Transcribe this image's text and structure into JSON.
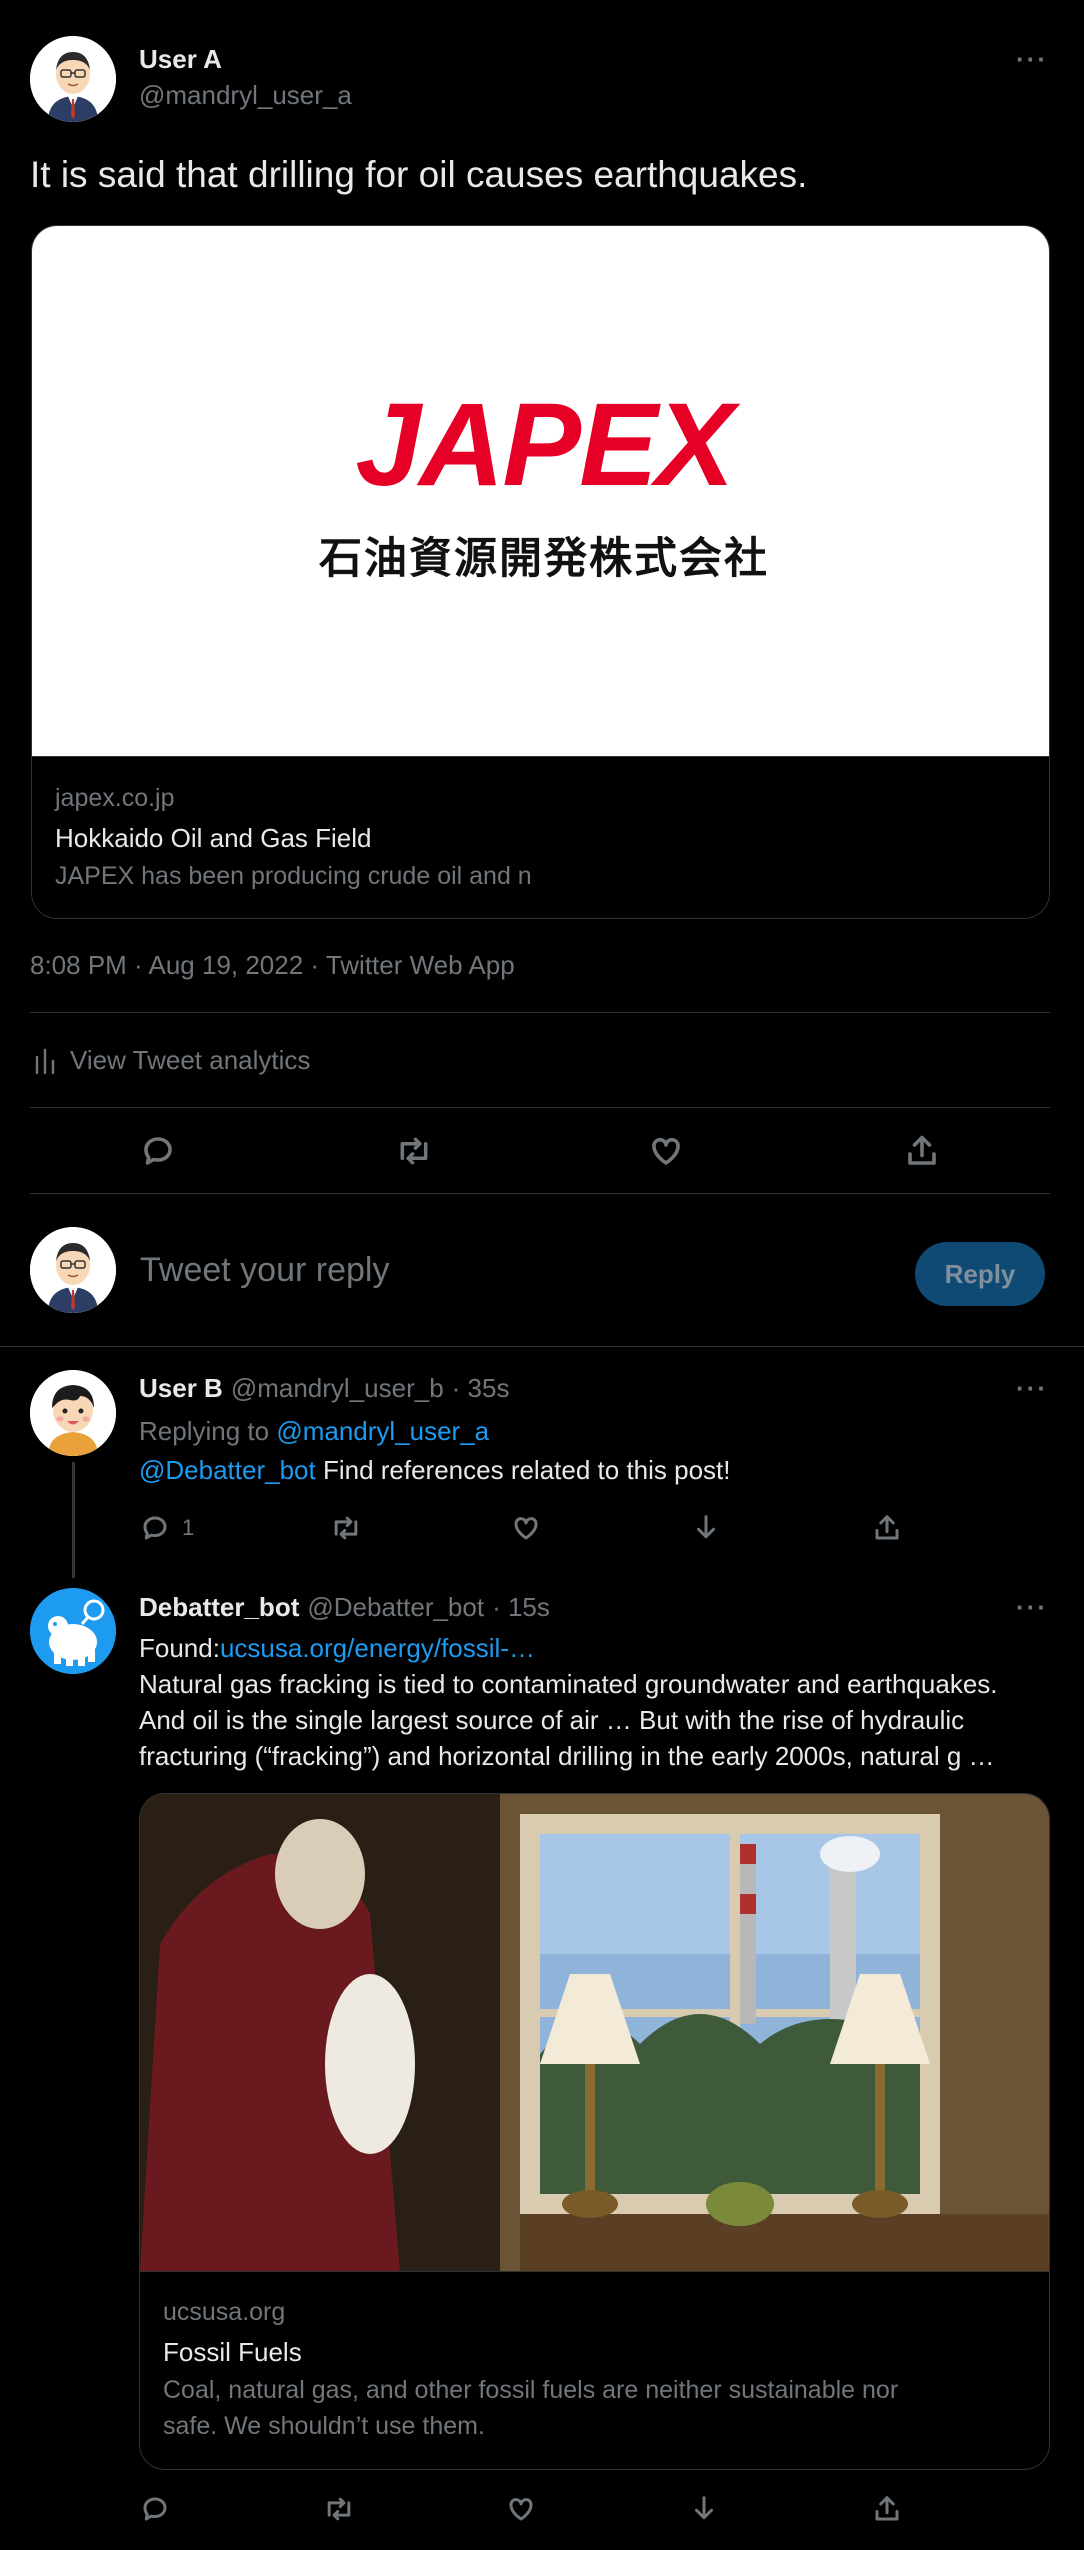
{
  "main_tweet": {
    "author_name": "User A",
    "author_handle": "@mandryl_user_a",
    "text": "It is said that drilling for oil causes earthquakes.",
    "card": {
      "logo_text": "JAPEX",
      "logo_subtext": "石油資源開発株式会社",
      "domain": "japex.co.jp",
      "title": "Hokkaido Oil and Gas Field",
      "description": "JAPEX has been producing crude oil and n"
    },
    "timestamp": "8:08 PM · Aug 19, 2022 · Twitter Web App",
    "analytics_label": "View Tweet analytics",
    "brand_color": "#e60026"
  },
  "composer": {
    "placeholder": "Tweet your reply",
    "reply_label": "Reply"
  },
  "reply1": {
    "author_name": "User B",
    "author_handle": "@mandryl_user_b",
    "time": "· 35s",
    "replying_prefix": "Replying to",
    "replying_to": "@mandryl_user_a",
    "mention": "@Debatter_bot",
    "text": "Find references related to this post!",
    "reply_count": "1"
  },
  "reply2": {
    "author_name": "Debatter_bot",
    "author_handle": "@Debatter_bot",
    "time": "· 15s",
    "found_prefix": "Found:",
    "found_link": "ucsusa.org/energy/fossil-…",
    "body_line1": "Natural gas fracking is tied to contaminated groundwater and earthquakes.",
    "body_line2": "And oil is the single largest source of air … But with the rise of hydraulic",
    "body_line3": "fracturing (“fracking”) and horizontal drilling in the early 2000s, natural g …",
    "card": {
      "domain": "ucsusa.org",
      "title": "Fossil Fuels",
      "desc_line1": "Coal, natural gas, and other fossil fuels are neither sustainable nor",
      "desc_line2": "safe. We shouldn’t use them."
    }
  },
  "colors": {
    "accent": "#1d9bf0",
    "reply_button_bg": "#0e4a73",
    "divider": "#2f3336",
    "muted": "#71767b"
  }
}
